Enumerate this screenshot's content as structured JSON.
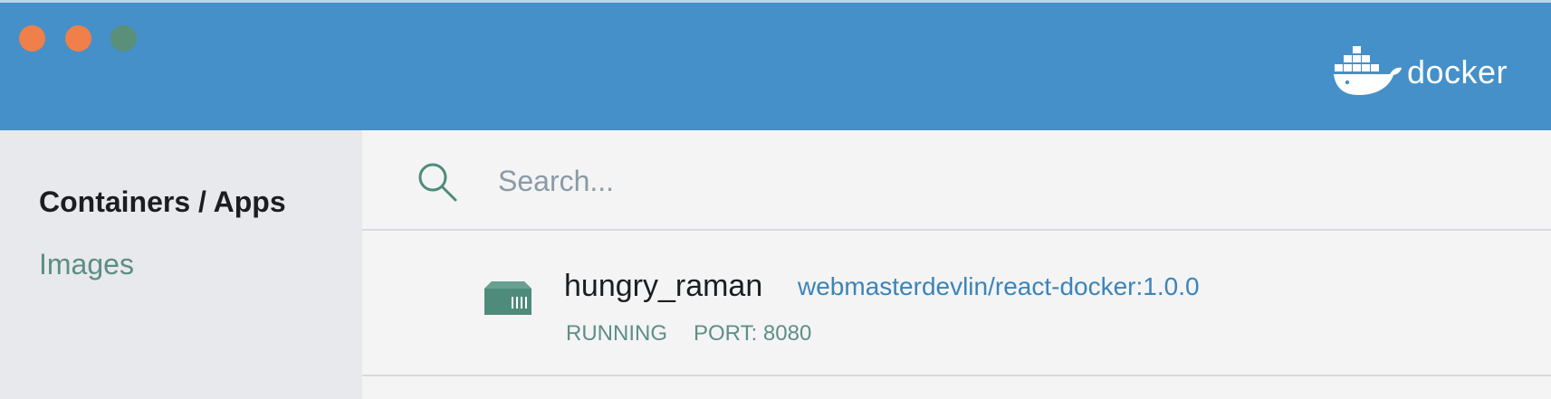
{
  "window": {
    "buttons": [
      "close",
      "minimize",
      "zoom"
    ],
    "traffic_colors": {
      "close": "#f07f4a",
      "minimize": "#f07f4a",
      "zoom": "#5a8f7a"
    }
  },
  "header": {
    "brand_name": "docker",
    "logo_icon": "docker-whale-icon",
    "background_color": "#4590c8"
  },
  "sidebar": {
    "items": [
      {
        "label": "Containers / Apps",
        "active": true
      },
      {
        "label": "Images",
        "active": false
      }
    ]
  },
  "search": {
    "icon": "search-icon",
    "placeholder": "Search...",
    "value": ""
  },
  "containers": [
    {
      "icon": "container-icon",
      "name": "hungry_raman",
      "image": "webmasterdevlin/react-docker:1.0.0",
      "status": "RUNNING",
      "port": "PORT: 8080"
    }
  ],
  "colors": {
    "accent": "#3c84b8",
    "status": "#5f8f86",
    "icon": "#4f8b7a"
  }
}
